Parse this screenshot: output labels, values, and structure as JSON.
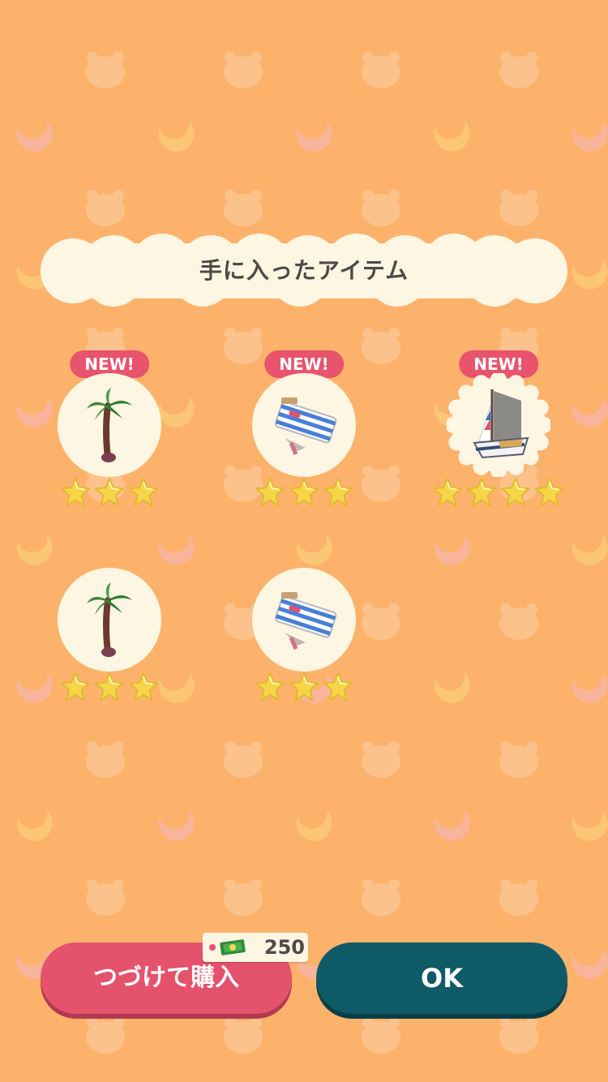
{
  "dialog": {
    "title": "手に入ったアイテム"
  },
  "items": [
    {
      "badge": "NEW!",
      "icon": "palm-tree-icon",
      "stars": 3
    },
    {
      "badge": "NEW!",
      "icon": "beach-chair-icon",
      "stars": 3
    },
    {
      "badge": "NEW!",
      "icon": "sailboat-icon",
      "stars": 4
    },
    {
      "badge": "",
      "icon": "palm-tree-icon",
      "stars": 3
    },
    {
      "badge": "",
      "icon": "beach-chair-icon",
      "stars": 3
    }
  ],
  "buttons": {
    "buy_more_label": "つづけて購入",
    "ok_label": "OK"
  },
  "price": {
    "currency_icon": "leaf-ticket-icon",
    "value": "250"
  },
  "colors": {
    "background": "#fdb26b",
    "badge": "#e8536d",
    "buy_button": "#e4526c",
    "ok_button": "#0e5a66"
  }
}
